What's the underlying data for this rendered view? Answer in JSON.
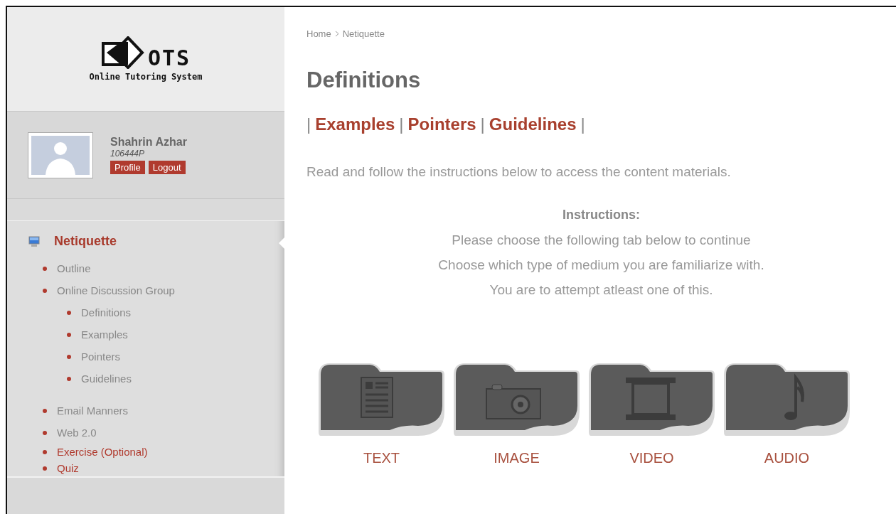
{
  "logo": {
    "mark": "OTS",
    "tagline": "Online Tutoring System"
  },
  "profile": {
    "name": "Shahrin Azhar",
    "id": "106444P",
    "buttons": [
      "Profile",
      "Logout"
    ]
  },
  "nav": {
    "title": "Netiquette",
    "items": [
      {
        "label": "Outline",
        "accent": false
      },
      {
        "label": "Online Discussion Group",
        "accent": false,
        "children": [
          {
            "label": "Definitions",
            "accent": false
          },
          {
            "label": "Examples",
            "accent": false
          },
          {
            "label": "Pointers",
            "accent": false
          },
          {
            "label": "Guidelines",
            "accent": false
          }
        ]
      },
      {
        "label": "Email Manners",
        "accent": false
      },
      {
        "label": "Web 2.0",
        "accent": false
      },
      {
        "label": "Exercise (Optional)",
        "accent": true
      },
      {
        "label": "Quiz",
        "accent": true
      }
    ]
  },
  "breadcrumb": [
    "Home",
    "Netiquette"
  ],
  "title": "Definitions",
  "link_bar": [
    {
      "kind": "separator",
      "text": "|"
    },
    {
      "kind": "link",
      "text": "Examples"
    },
    {
      "kind": "separator",
      "text": "|"
    },
    {
      "kind": "link",
      "text": "Pointers"
    },
    {
      "kind": "separator",
      "text": "|"
    },
    {
      "kind": "link",
      "text": "Guidelines"
    },
    {
      "kind": "separator",
      "text": "|"
    }
  ],
  "intro": "Read and follow the instructions below to access the content materials.",
  "instructions": {
    "heading": "Instructions:",
    "lines": [
      "Please choose the following tab below to continue",
      "Choose which type of medium you are familiarize with.",
      "You are to attempt atleast one of this."
    ]
  },
  "media": [
    {
      "kind": "text",
      "label": "TEXT"
    },
    {
      "kind": "image",
      "label": "IMAGE"
    },
    {
      "kind": "video",
      "label": "VIDEO"
    },
    {
      "kind": "audio",
      "label": "AUDIO"
    }
  ]
}
